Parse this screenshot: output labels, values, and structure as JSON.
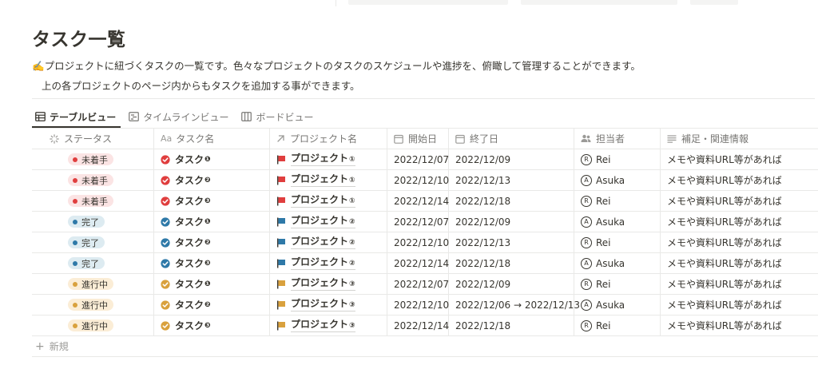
{
  "page": {
    "title": "タスク一覧",
    "description_line1": "✍️プロジェクトに紐づくタスクの一覧です。色々なプロジェクトのタスクのスケジュールや進捗を、俯瞰して管理することができます。",
    "description_line2": "上の各プロジェクトのページ内からもタスクを追加する事ができます。"
  },
  "tabs": [
    {
      "label": "テーブルビュー",
      "icon": "table-icon",
      "active": true
    },
    {
      "label": "タイムラインビュー",
      "icon": "timeline-icon",
      "active": false
    },
    {
      "label": "ボードビュー",
      "icon": "board-icon",
      "active": false
    }
  ],
  "columns": [
    {
      "label": "ステータス",
      "icon": "status-icon"
    },
    {
      "label": "タスク名",
      "icon": "text-aa-icon"
    },
    {
      "label": "プロジェクト名",
      "icon": "relation-arrow-icon"
    },
    {
      "label": "開始日",
      "icon": "calendar-icon"
    },
    {
      "label": "終了日",
      "icon": "calendar-icon"
    },
    {
      "label": "担当者",
      "icon": "people-icon"
    },
    {
      "label": "補足・関連情報",
      "icon": "text-lines-icon"
    }
  ],
  "status_colors": {
    "未着手": {
      "bg": "#fbe4e4",
      "dot": "#e03e3e",
      "flag": "#e03e3e"
    },
    "完了": {
      "bg": "#ddebf1",
      "dot": "#2e79a8",
      "flag": "#2e79a8"
    },
    "進行中": {
      "bg": "#fbedd6",
      "dot": "#d9a13d",
      "flag": "#d9a13d"
    }
  },
  "rows": [
    {
      "status": "未着手",
      "task": "タスク",
      "task_num": "❶",
      "project": "プロジェクト",
      "project_num": "①",
      "start": "2022/12/07",
      "end": "2022/12/09",
      "assignee_initial": "R",
      "assignee": "Rei",
      "note": "メモや資料URL等があれば"
    },
    {
      "status": "未着手",
      "task": "タスク",
      "task_num": "❷",
      "project": "プロジェクト",
      "project_num": "①",
      "start": "2022/12/10",
      "end": "2022/12/13",
      "assignee_initial": "A",
      "assignee": "Asuka",
      "note": "メモや資料URL等があれば"
    },
    {
      "status": "未着手",
      "task": "タスク",
      "task_num": "❸",
      "project": "プロジェクト",
      "project_num": "①",
      "start": "2022/12/14",
      "end": "2022/12/18",
      "assignee_initial": "R",
      "assignee": "Rei",
      "note": "メモや資料URL等があれば"
    },
    {
      "status": "完了",
      "task": "タスク",
      "task_num": "❶",
      "project": "プロジェクト",
      "project_num": "②",
      "start": "2022/12/07",
      "end": "2022/12/09",
      "assignee_initial": "A",
      "assignee": "Asuka",
      "note": "メモや資料URL等があれば"
    },
    {
      "status": "完了",
      "task": "タスク",
      "task_num": "❷",
      "project": "プロジェクト",
      "project_num": "②",
      "start": "2022/12/10",
      "end": "2022/12/13",
      "assignee_initial": "R",
      "assignee": "Rei",
      "note": "メモや資料URL等があれば"
    },
    {
      "status": "完了",
      "task": "タスク",
      "task_num": "❸",
      "project": "プロジェクト",
      "project_num": "②",
      "start": "2022/12/14",
      "end": "2022/12/18",
      "assignee_initial": "A",
      "assignee": "Asuka",
      "note": "メモや資料URL等があれば"
    },
    {
      "status": "進行中",
      "task": "タスク",
      "task_num": "❶",
      "project": "プロジェクト",
      "project_num": "③",
      "start": "2022/12/07",
      "end": "2022/12/09",
      "assignee_initial": "R",
      "assignee": "Rei",
      "note": "メモや資料URL等があれば"
    },
    {
      "status": "進行中",
      "task": "タスク",
      "task_num": "❷",
      "project": "プロジェクト",
      "project_num": "③",
      "start": "2022/12/10",
      "end": "2022/12/06 → 2022/12/13",
      "assignee_initial": "A",
      "assignee": "Asuka",
      "note": "メモや資料URL等があれば"
    },
    {
      "status": "進行中",
      "task": "タスク",
      "task_num": "❸",
      "project": "プロジェクト",
      "project_num": "③",
      "start": "2022/12/14",
      "end": "2022/12/18",
      "assignee_initial": "R",
      "assignee": "Rei",
      "note": "メモや資料URL等があれば"
    }
  ],
  "new_row_label": "新規"
}
